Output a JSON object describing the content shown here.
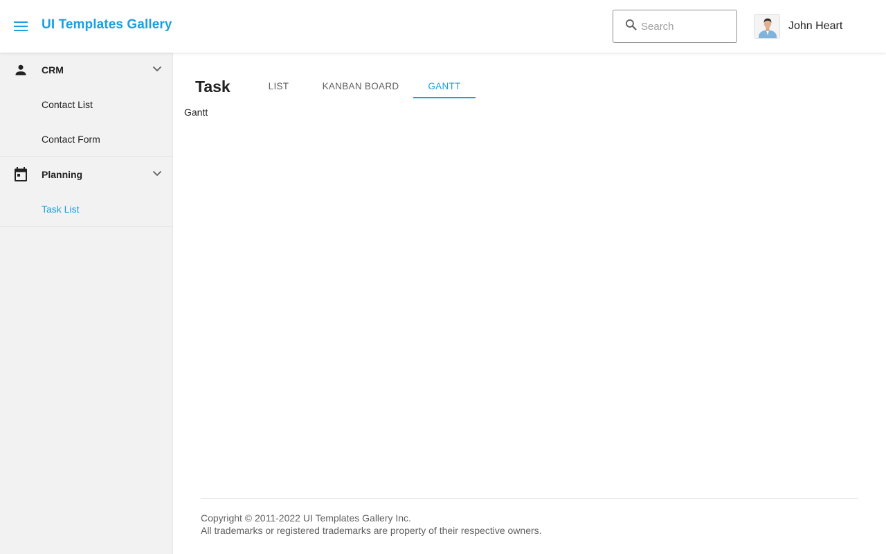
{
  "header": {
    "title": "UI Templates Gallery",
    "search": {
      "placeholder": "Search",
      "value": ""
    },
    "user": {
      "name": "John Heart"
    }
  },
  "sidebar": {
    "groups": [
      {
        "label": "CRM",
        "icon": "person-icon",
        "items": [
          {
            "label": "Contact List",
            "active": false
          },
          {
            "label": "Contact Form",
            "active": false
          }
        ]
      },
      {
        "label": "Planning",
        "icon": "calendar-icon",
        "items": [
          {
            "label": "Task List",
            "active": true
          }
        ]
      }
    ]
  },
  "main": {
    "title": "Task",
    "tabs": [
      {
        "label": "LIST",
        "active": false
      },
      {
        "label": "KANBAN BOARD",
        "active": false
      },
      {
        "label": "GANTT",
        "active": true
      }
    ],
    "content_text": "Gantt"
  },
  "footer": {
    "copyright": "Copyright © 2011-2022 UI Templates Gallery Inc.",
    "trademarks": "All trademarks or registered trademarks are property of their respective owners."
  },
  "colors": {
    "accent": "#1a9fe0",
    "sidebar_bg": "#f2f2f2",
    "text": "#212121",
    "muted": "#5f5f5f"
  }
}
